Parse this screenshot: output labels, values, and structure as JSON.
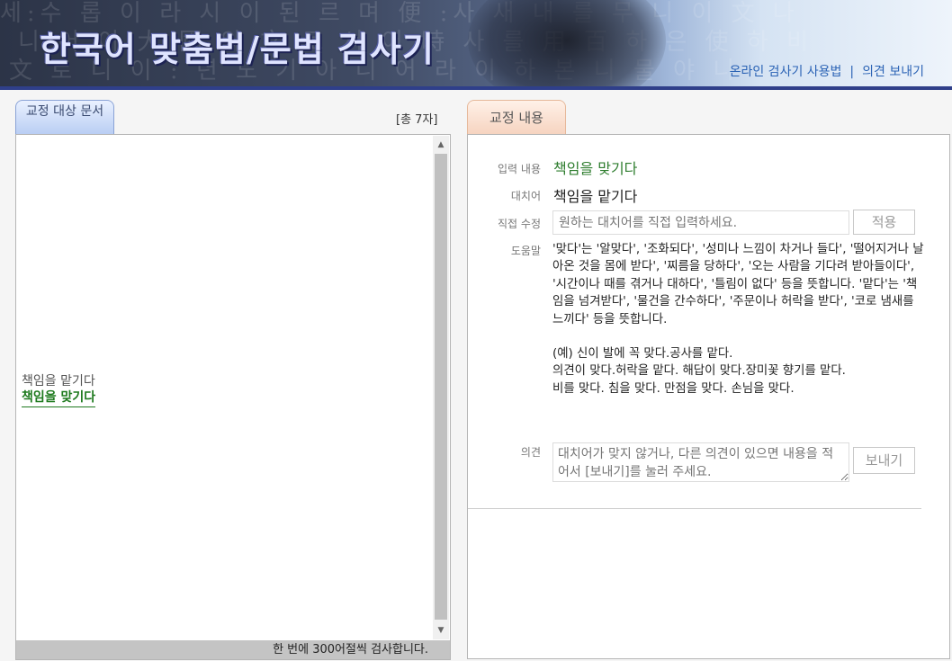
{
  "header": {
    "title": "한국어 맞춤법/문법 검사기",
    "watermark_rows": [
      "세:수 롭 이 라 시 이 된 르 며 便 :사 새 내 를 무 니 이 文 나",
      "니 어 이 大 國 와 文 로 서 어 時 사 를 用 百 하 은 使 하 비",
      "文 로 니 이 : 년 노 기 아 니 어 라 이 하 본 니 물 야 니"
    ],
    "links": [
      "온라인 검사기 사용법",
      "의견 보내기"
    ],
    "separator": "|"
  },
  "left": {
    "tab_label": "교정 대상 문서",
    "char_count": "[총 7자]",
    "original_text": "책임을 맡기다",
    "corrected_text": "책임을 맞기다",
    "footer_note": "한 번에 300어절씩 검사합니다.",
    "scroll_up": "▲",
    "scroll_down": "▼"
  },
  "right": {
    "tab_label": "교정 내용",
    "input_label": "입력 내용",
    "input_value": "책임을 맞기다",
    "correction_label": "대치어",
    "correction_value": "책임을 맡기다",
    "edit_label": "직접 수정",
    "edit_placeholder": "원하는 대치어를 직접 입력하세요.",
    "apply_button": "적용",
    "help_label": "도움말",
    "help_text": "'맞다'는 '알맞다', '조화되다', '성미나 느낌이 차거나 들다', '떨어지거나 날아온 것을 몸에 받다', '찌름을 당하다', '오는 사람을 기다려 받아들이다', '시간이나 때를 겪거나 대하다', '틀림이 없다' 등을 뜻합니다. '맡다'는 '책임을 넘겨받다', '물건을 간수하다', '주문이나 허락을 받다', '코로 냄새를 느끼다' 등을 뜻합니다.",
    "examples": [
      "(예) 신이 발에 꼭 맞다.공사를 맡다.",
      "의견이 맞다.허락을 맡다. 해답이 맞다.장미꽃 향기를 맡다.",
      "비를 맞다. 침을 맞다. 만점을 맞다. 손님을 맞다."
    ],
    "opinion_label": "의견",
    "opinion_placeholder": "대치어가 맞지 않거나, 다른 의견이 있으면 내용을 적어서 [보내기]를 눌러 주세요.",
    "send_button": "보내기"
  },
  "colors": {
    "header_line": "#2f3f8a",
    "link": "#2b63b5",
    "correct_green": "#1e7a1e"
  }
}
